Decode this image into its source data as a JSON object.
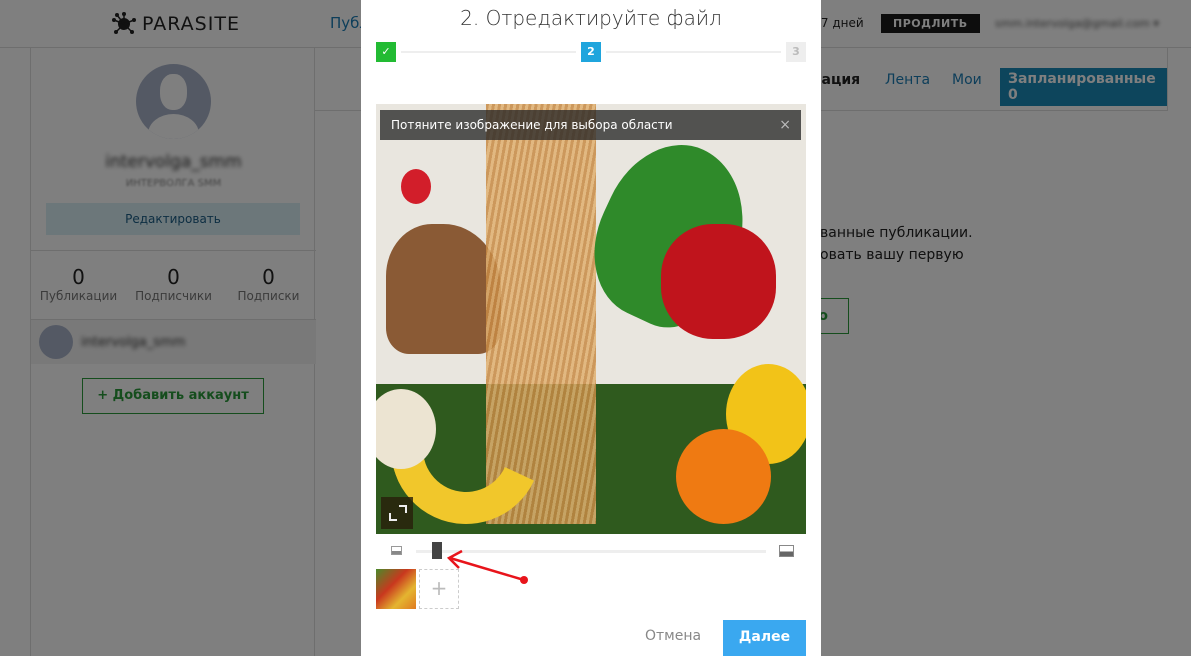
{
  "header": {
    "logo": "PARASITE",
    "nav_publications": "Публ",
    "trial_text": "ь 7 дней",
    "renew_label": "ПРОДЛИТЬ",
    "user_email": "smm.intervolga@gmail.com ▾"
  },
  "sidebar": {
    "username": "intervolga_smm",
    "subtitle": "ИНТЕРВОЛГА SMM",
    "edit_label": "Редактировать",
    "stats": [
      {
        "value": "0",
        "label": "Публикации"
      },
      {
        "value": "0",
        "label": "Подписчики"
      },
      {
        "value": "0",
        "label": "Подписки"
      }
    ],
    "account_name": "intervolga_smm",
    "add_account_label": "+ Добавить аккаунт"
  },
  "tabs": {
    "publication": "кация",
    "feed": "Лента",
    "mine": "Мои",
    "scheduled": "Запланированные 0"
  },
  "main": {
    "empty_line1": "ванные публикации.",
    "empty_line2": "овать вашу первую",
    "create_label": "о"
  },
  "modal": {
    "title": "2. Отредактируйте файл",
    "steps": [
      {
        "label": "✓",
        "state": "done"
      },
      {
        "label": "2",
        "state": "active"
      },
      {
        "label": "3",
        "state": "pending"
      }
    ],
    "hint": "Потяните изображение для выбора области",
    "hint_close": "×",
    "zoom_level_percent": 6,
    "add_thumb": "+",
    "cancel_label": "Отмена",
    "next_label": "Далее"
  },
  "colors": {
    "accent": "#1fa5dd",
    "success": "#22bb33",
    "next_button": "#3aa8f0",
    "annotation_arrow": "#e8141b"
  }
}
